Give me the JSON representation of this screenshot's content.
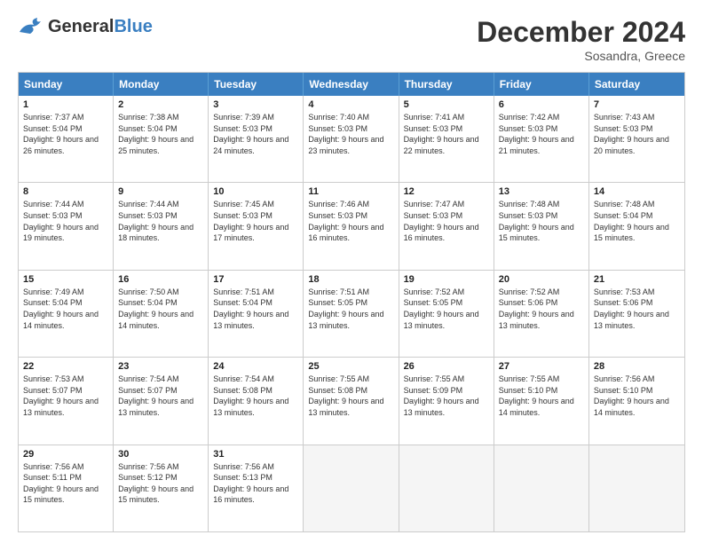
{
  "logo": {
    "general": "General",
    "blue": "Blue"
  },
  "title": "December 2024",
  "location": "Sosandra, Greece",
  "weekdays": [
    "Sunday",
    "Monday",
    "Tuesday",
    "Wednesday",
    "Thursday",
    "Friday",
    "Saturday"
  ],
  "weeks": [
    [
      {
        "day": "1",
        "info": "Sunrise: 7:37 AM\nSunset: 5:04 PM\nDaylight: 9 hours and 26 minutes."
      },
      {
        "day": "2",
        "info": "Sunrise: 7:38 AM\nSunset: 5:04 PM\nDaylight: 9 hours and 25 minutes."
      },
      {
        "day": "3",
        "info": "Sunrise: 7:39 AM\nSunset: 5:03 PM\nDaylight: 9 hours and 24 minutes."
      },
      {
        "day": "4",
        "info": "Sunrise: 7:40 AM\nSunset: 5:03 PM\nDaylight: 9 hours and 23 minutes."
      },
      {
        "day": "5",
        "info": "Sunrise: 7:41 AM\nSunset: 5:03 PM\nDaylight: 9 hours and 22 minutes."
      },
      {
        "day": "6",
        "info": "Sunrise: 7:42 AM\nSunset: 5:03 PM\nDaylight: 9 hours and 21 minutes."
      },
      {
        "day": "7",
        "info": "Sunrise: 7:43 AM\nSunset: 5:03 PM\nDaylight: 9 hours and 20 minutes."
      }
    ],
    [
      {
        "day": "8",
        "info": "Sunrise: 7:44 AM\nSunset: 5:03 PM\nDaylight: 9 hours and 19 minutes."
      },
      {
        "day": "9",
        "info": "Sunrise: 7:44 AM\nSunset: 5:03 PM\nDaylight: 9 hours and 18 minutes."
      },
      {
        "day": "10",
        "info": "Sunrise: 7:45 AM\nSunset: 5:03 PM\nDaylight: 9 hours and 17 minutes."
      },
      {
        "day": "11",
        "info": "Sunrise: 7:46 AM\nSunset: 5:03 PM\nDaylight: 9 hours and 16 minutes."
      },
      {
        "day": "12",
        "info": "Sunrise: 7:47 AM\nSunset: 5:03 PM\nDaylight: 9 hours and 16 minutes."
      },
      {
        "day": "13",
        "info": "Sunrise: 7:48 AM\nSunset: 5:03 PM\nDaylight: 9 hours and 15 minutes."
      },
      {
        "day": "14",
        "info": "Sunrise: 7:48 AM\nSunset: 5:04 PM\nDaylight: 9 hours and 15 minutes."
      }
    ],
    [
      {
        "day": "15",
        "info": "Sunrise: 7:49 AM\nSunset: 5:04 PM\nDaylight: 9 hours and 14 minutes."
      },
      {
        "day": "16",
        "info": "Sunrise: 7:50 AM\nSunset: 5:04 PM\nDaylight: 9 hours and 14 minutes."
      },
      {
        "day": "17",
        "info": "Sunrise: 7:51 AM\nSunset: 5:04 PM\nDaylight: 9 hours and 13 minutes."
      },
      {
        "day": "18",
        "info": "Sunrise: 7:51 AM\nSunset: 5:05 PM\nDaylight: 9 hours and 13 minutes."
      },
      {
        "day": "19",
        "info": "Sunrise: 7:52 AM\nSunset: 5:05 PM\nDaylight: 9 hours and 13 minutes."
      },
      {
        "day": "20",
        "info": "Sunrise: 7:52 AM\nSunset: 5:06 PM\nDaylight: 9 hours and 13 minutes."
      },
      {
        "day": "21",
        "info": "Sunrise: 7:53 AM\nSunset: 5:06 PM\nDaylight: 9 hours and 13 minutes."
      }
    ],
    [
      {
        "day": "22",
        "info": "Sunrise: 7:53 AM\nSunset: 5:07 PM\nDaylight: 9 hours and 13 minutes."
      },
      {
        "day": "23",
        "info": "Sunrise: 7:54 AM\nSunset: 5:07 PM\nDaylight: 9 hours and 13 minutes."
      },
      {
        "day": "24",
        "info": "Sunrise: 7:54 AM\nSunset: 5:08 PM\nDaylight: 9 hours and 13 minutes."
      },
      {
        "day": "25",
        "info": "Sunrise: 7:55 AM\nSunset: 5:08 PM\nDaylight: 9 hours and 13 minutes."
      },
      {
        "day": "26",
        "info": "Sunrise: 7:55 AM\nSunset: 5:09 PM\nDaylight: 9 hours and 13 minutes."
      },
      {
        "day": "27",
        "info": "Sunrise: 7:55 AM\nSunset: 5:10 PM\nDaylight: 9 hours and 14 minutes."
      },
      {
        "day": "28",
        "info": "Sunrise: 7:56 AM\nSunset: 5:10 PM\nDaylight: 9 hours and 14 minutes."
      }
    ],
    [
      {
        "day": "29",
        "info": "Sunrise: 7:56 AM\nSunset: 5:11 PM\nDaylight: 9 hours and 15 minutes."
      },
      {
        "day": "30",
        "info": "Sunrise: 7:56 AM\nSunset: 5:12 PM\nDaylight: 9 hours and 15 minutes."
      },
      {
        "day": "31",
        "info": "Sunrise: 7:56 AM\nSunset: 5:13 PM\nDaylight: 9 hours and 16 minutes."
      },
      {
        "day": "",
        "info": ""
      },
      {
        "day": "",
        "info": ""
      },
      {
        "day": "",
        "info": ""
      },
      {
        "day": "",
        "info": ""
      }
    ]
  ]
}
